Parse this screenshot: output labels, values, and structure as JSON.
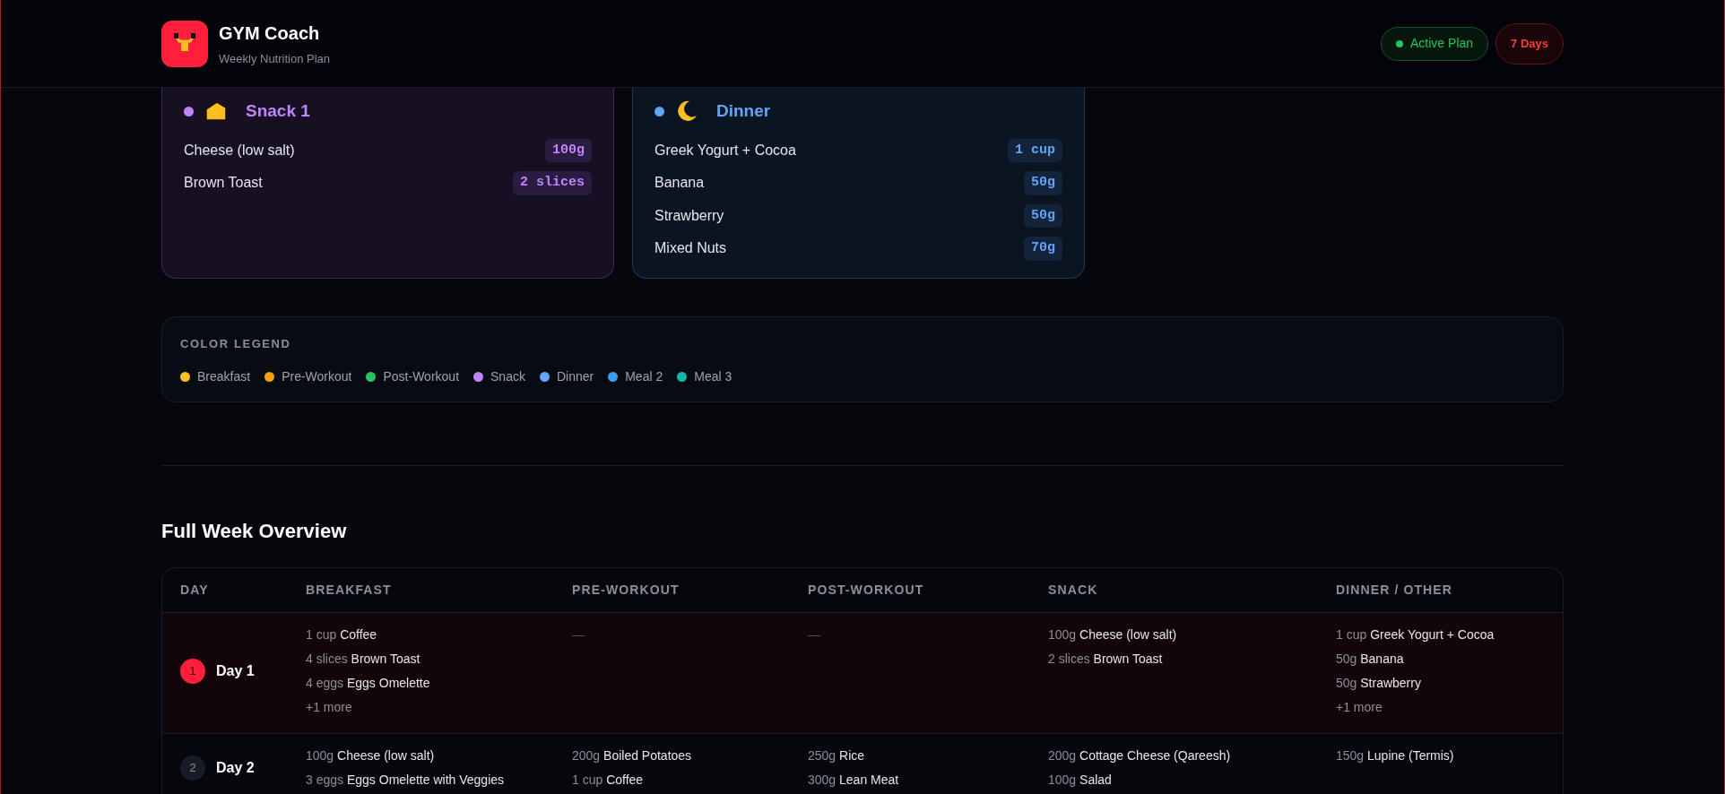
{
  "header": {
    "title": "GYM Coach",
    "subtitle": "Weekly Nutrition Plan",
    "status": "Active Plan",
    "days": "7 Days"
  },
  "meal_cards": [
    {
      "title": "Snack 1",
      "color": "#c084fc",
      "kind": "snack",
      "items": [
        {
          "name": "Cheese (low salt)",
          "amount": "100g"
        },
        {
          "name": "Brown Toast",
          "amount": "2 slices"
        }
      ]
    },
    {
      "title": "Dinner",
      "color": "#60a5fa",
      "kind": "dinner",
      "items": [
        {
          "name": "Greek Yogurt + Cocoa",
          "amount": "1 cup"
        },
        {
          "name": "Banana",
          "amount": "50g"
        },
        {
          "name": "Strawberry",
          "amount": "50g"
        },
        {
          "name": "Mixed Nuts",
          "amount": "70g"
        }
      ]
    }
  ],
  "legend": {
    "title": "COLOR LEGEND",
    "items": [
      {
        "label": "Breakfast",
        "color": "#fbbf24"
      },
      {
        "label": "Pre-Workout",
        "color": "#f59e0b"
      },
      {
        "label": "Post-Workout",
        "color": "#22c55e"
      },
      {
        "label": "Snack",
        "color": "#c084fc"
      },
      {
        "label": "Dinner",
        "color": "#60a5fa"
      },
      {
        "label": "Meal 2",
        "color": "#3b9cf6"
      },
      {
        "label": "Meal 3",
        "color": "#14b8a6"
      }
    ]
  },
  "overview": {
    "title": "Full Week Overview",
    "columns": [
      "DAY",
      "BREAKFAST",
      "PRE-WORKOUT",
      "POST-WORKOUT",
      "SNACK",
      "DINNER / OTHER"
    ],
    "rows": [
      {
        "selected": true,
        "cells": [
          {
            "kind": "day",
            "number": "1",
            "label": "Day 1"
          },
          {
            "kind": "meals",
            "items": [
              {
                "qty": "1 cup",
                "name": "Coffee"
              },
              {
                "qty": "4 slices",
                "name": "Brown Toast"
              },
              {
                "qty": "4 eggs",
                "name": "Eggs Omelette"
              }
            ],
            "more": "+1 more"
          },
          {
            "kind": "empty",
            "text": "—"
          },
          {
            "kind": "empty",
            "text": "—"
          },
          {
            "kind": "meals",
            "items": [
              {
                "qty": "100g",
                "name": "Cheese (low salt)"
              },
              {
                "qty": "2 slices",
                "name": "Brown Toast"
              }
            ]
          },
          {
            "kind": "meals",
            "items": [
              {
                "qty": "1 cup",
                "name": "Greek Yogurt + Cocoa"
              },
              {
                "qty": "50g",
                "name": "Banana"
              },
              {
                "qty": "50g",
                "name": "Strawberry"
              }
            ],
            "more": "+1 more"
          }
        ]
      },
      {
        "selected": false,
        "cells": [
          {
            "kind": "day",
            "number": "2",
            "label": "Day 2"
          },
          {
            "kind": "meals",
            "items": [
              {
                "qty": "100g",
                "name": "Cheese (low salt)"
              },
              {
                "qty": "3 eggs",
                "name": "Eggs Omelette with Veggies"
              }
            ]
          },
          {
            "kind": "meals",
            "items": [
              {
                "qty": "200g",
                "name": "Boiled Potatoes"
              },
              {
                "qty": "1 cup",
                "name": "Coffee"
              }
            ]
          },
          {
            "kind": "meals",
            "items": [
              {
                "qty": "250g",
                "name": "Rice"
              },
              {
                "qty": "300g",
                "name": "Lean Meat"
              }
            ]
          },
          {
            "kind": "meals",
            "items": [
              {
                "qty": "200g",
                "name": "Cottage Cheese (Qareesh)"
              },
              {
                "qty": "100g",
                "name": "Salad"
              }
            ]
          },
          {
            "kind": "meals",
            "items": [
              {
                "qty": "150g",
                "name": "Lupine (Termis)"
              }
            ]
          }
        ]
      }
    ]
  }
}
